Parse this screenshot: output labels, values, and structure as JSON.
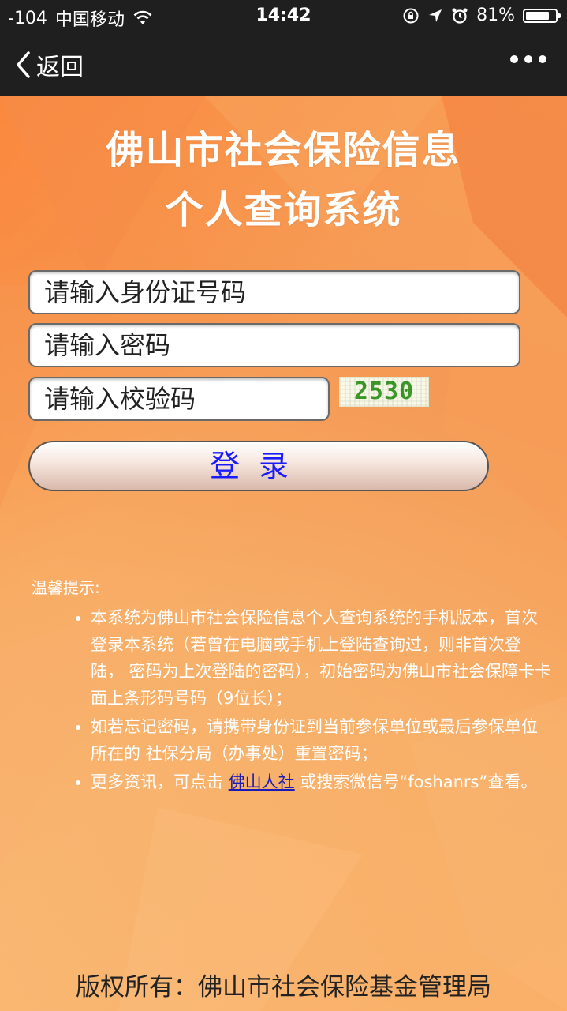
{
  "status_bar": {
    "signal": "-104",
    "carrier": "中国移动",
    "time": "14:42",
    "battery_percent": "81%",
    "battery_level": 0.81
  },
  "nav": {
    "back_label": "返回",
    "more_icon": "more-dots-icon"
  },
  "page": {
    "title_line1": "佛山市社会保险信息",
    "title_line2": "个人查询系统"
  },
  "form": {
    "id_placeholder": "请输入身份证号码",
    "password_placeholder": "请输入密码",
    "captcha_placeholder": "请输入校验码",
    "captcha_value": "2530",
    "login_label": "登录"
  },
  "tips": {
    "title": "温馨提示:",
    "items": [
      "本系统为佛山市社会保险信息个人查询系统的手机版本，首次登录本系统（若曾在电脑或手机上登陆查询过，则非首次登陆， 密码为上次登陆的密码），初始密码为佛山市社会保障卡卡面上条形码号码（9位长）；",
      "如若忘记密码，请携带身份证到当前参保单位或最后参保单位所在的 社保分局（办事处）重置密码；"
    ],
    "item3_prefix": "更多资讯，可点击 ",
    "item3_link": "佛山人社",
    "item3_suffix": " 或搜索微信号“foshanrs”查看。"
  },
  "footer": {
    "copyright": "版权所有：佛山市社会保险基金管理局"
  },
  "colors": {
    "background": "#f4a85c",
    "link": "#1a1ab8",
    "login_text": "#1a1aff",
    "captcha_text": "#3c9a2a"
  }
}
